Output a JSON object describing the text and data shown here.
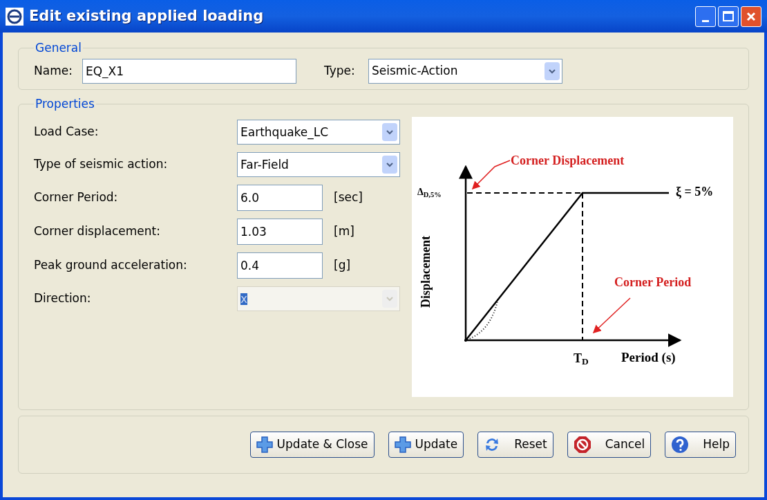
{
  "window": {
    "title": "Edit existing applied loading"
  },
  "general": {
    "legend": "General",
    "name_label": "Name:",
    "name_value": "EQ_X1",
    "type_label": "Type:",
    "type_value": "Seismic-Action"
  },
  "properties": {
    "legend": "Properties",
    "rows": [
      {
        "kind": "combo",
        "label": "Load Case:",
        "value": "Earthquake_LC",
        "disabled": false,
        "selected_text": false
      },
      {
        "kind": "combo",
        "label": "Type of seismic action:",
        "value": "Far-Field",
        "disabled": false,
        "selected_text": false
      },
      {
        "kind": "text",
        "label": "Corner Period:",
        "value": "6.0",
        "unit": "[sec]"
      },
      {
        "kind": "text",
        "label": "Corner displacement:",
        "value": "1.03",
        "unit": "[m]"
      },
      {
        "kind": "text",
        "label": "Peak ground acceleration:",
        "value": "0.4",
        "unit": "[g]"
      },
      {
        "kind": "combo",
        "label": "Direction:",
        "value": "x",
        "disabled": true,
        "selected_text": true
      }
    ]
  },
  "figure": {
    "corner_displacement": "Corner Displacement",
    "delta_label": "Δ$_{D,5%}$",
    "damping": "ξ = 5%",
    "y_axis": "Displacement",
    "corner_period": "Corner Period",
    "td_label": "T$_{D}$",
    "x_axis": "Period (s)"
  },
  "buttons": [
    {
      "kind": "add",
      "label": "Update & Close"
    },
    {
      "kind": "add",
      "label": "Update"
    },
    {
      "kind": "reset",
      "label": "Reset"
    },
    {
      "kind": "cancel",
      "label": "Cancel"
    },
    {
      "kind": "help",
      "label": "Help"
    }
  ]
}
